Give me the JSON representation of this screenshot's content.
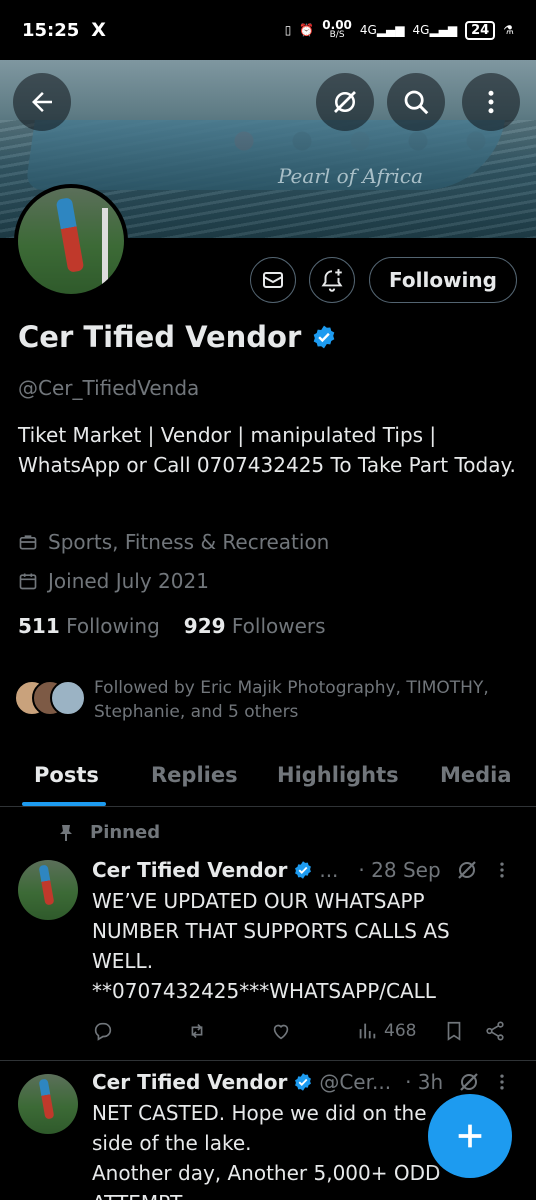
{
  "status_bar": {
    "time": "15:25",
    "app_icon": "X",
    "speed": "0.00",
    "speed_unit": "B/S",
    "net1": "4G",
    "net2": "4G",
    "battery": "24"
  },
  "header": {
    "back_icon": "arrow-left-icon",
    "grok_icon": "grok-icon",
    "search_icon": "search-icon",
    "more_icon": "more-vertical-icon",
    "banner_text": "Pearl of Africa"
  },
  "profile": {
    "name": "Cer Tified Vendor",
    "handle": "@Cer_TifiedVenda",
    "bio": "Tiket Market | Vendor | manipulated Tips | WhatsApp or Call 0707432425 To Take Part Today.",
    "category": "Sports, Fitness & Recreation",
    "joined": "Joined July 2021",
    "following_count": "511",
    "following_label": "Following",
    "followers_count": "929",
    "followers_label": "Followers",
    "followed_by": "Followed by Eric Majik Photography, TIMOTHY, Stephanie, and 5 others",
    "follow_button": "Following"
  },
  "tabs": [
    "Posts",
    "Replies",
    "Highlights",
    "Media"
  ],
  "pinned_label": "Pinned",
  "tweets": [
    {
      "name": "Cer Tified Vendor",
      "handle": "...",
      "time": "· 28 Sep",
      "lines": [
        "WE’VE UPDATED OUR WHATSAPP",
        "NUMBER THAT SUPPORTS CALLS AS",
        "WELL.",
        "**0707432425***WHATSAPP/CALL"
      ],
      "views": "468"
    },
    {
      "name": "Cer Tified Vendor",
      "handle": "@Cer...",
      "time": "· 3h",
      "lines": [
        "NET CASTED. Hope we did on the",
        "side of the lake.",
        "Another day, Another 5,000+ ODD",
        "ATTEMPT"
      ]
    }
  ],
  "colors": {
    "accent": "#1d9bf0",
    "muted": "#71767b",
    "text": "#e7e9ea",
    "bg": "#000000"
  }
}
